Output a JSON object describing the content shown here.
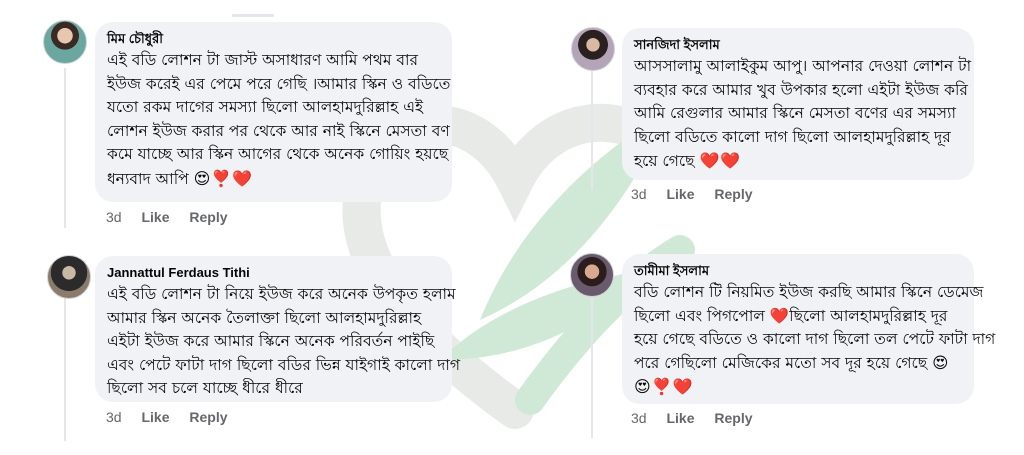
{
  "comments": [
    {
      "author": "মিম চৌধুরী",
      "lines": [
        "এই বডি লোশন  টা জাস্ট অসাধারণ আমি পথম বার",
        "ইউজ করেই এর পেমে পরে গেছি ।আমার স্কিন ও বডিতে",
        "যতো রকম দাগের সমস্যা ছিলো আলহামদুরিল্লাহ এই",
        "লোশন ইউজ করার পর থেকে আর নাই স্কিনে মেসতা বণ",
        "কমে যাচ্ছে আর স্কিন আগের থেকে অনেক গোয়িং হয়ছে",
        "ধন্যবাদ আপি"
      ],
      "emojis": "😍❣️❤️",
      "time": "3d",
      "like": "Like",
      "reply": "Reply"
    },
    {
      "author": "Jannattul Ferdaus Tithi",
      "lines": [
        "এই বডি লোশন  টা নিয়ে ইউজ করে অনেক উপকৃত হলাম",
        "আমার স্কিন অনেক তৈলাক্তা ছিলো আলহামদুরিল্লাহ",
        "এইটা ইউজ করে আমার স্কিনে অনেক পরিবর্তন পাইছি",
        "এবং পেটে ফাটা দাগ ছিলো বডির ভিন্ন যাইগাই কালো দাগ",
        "ছিলো সব চলে যাচ্ছে ধীরে ধীরে"
      ],
      "emojis": "",
      "time": "3d",
      "like": "Like",
      "reply": "Reply"
    },
    {
      "author": "সানজিদা ইসলাম",
      "lines": [
        "আসসালামু আলাইকুম আপু। আপনার দেওয়া লোশন টা",
        "ব্যবহার করে আমার খুব উপকার হলো এইটা ইউজ করি",
        "আমি রেগুলার আমার স্কিনে মেসতা বণের এর সমস্যা",
        "ছিলো বডিতে কালো দাগ ছিলো  আলহামদুরিল্লাহ দূর",
        "হয়ে গেছে"
      ],
      "emojis": "❤️❤️",
      "time": "3d",
      "like": "Like",
      "reply": "Reply"
    },
    {
      "author": "তামীমা ইসলাম",
      "lines": [
        "বডি লোশন টি নিয়মিত ইউজ করছি আমার স্কিনে ডেমেজ",
        "ছিলো এবং পিগপোল ❤️ছিলো আলহামদুরিল্লাহ দূর",
        "হয়ে গেছে বডিতে ও কালো দাগ ছিলো তল পেটে ফাটা দাগ",
        "পরে গেছিলো মেজিকের মতো সব দূর হয়ে গেছে 😍",
        ""
      ],
      "emojis": "😍❣️❤️",
      "time": "3d",
      "like": "Like",
      "reply": "Reply"
    }
  ],
  "colors": {
    "bubble": "#f0f2f5",
    "meta": "#65676b",
    "watermark": "#2f9e4f"
  },
  "icons": [
    "leaf-heart-watermark",
    "heart-emoji",
    "heart-eyes-emoji",
    "heart-exclamation-emoji"
  ]
}
